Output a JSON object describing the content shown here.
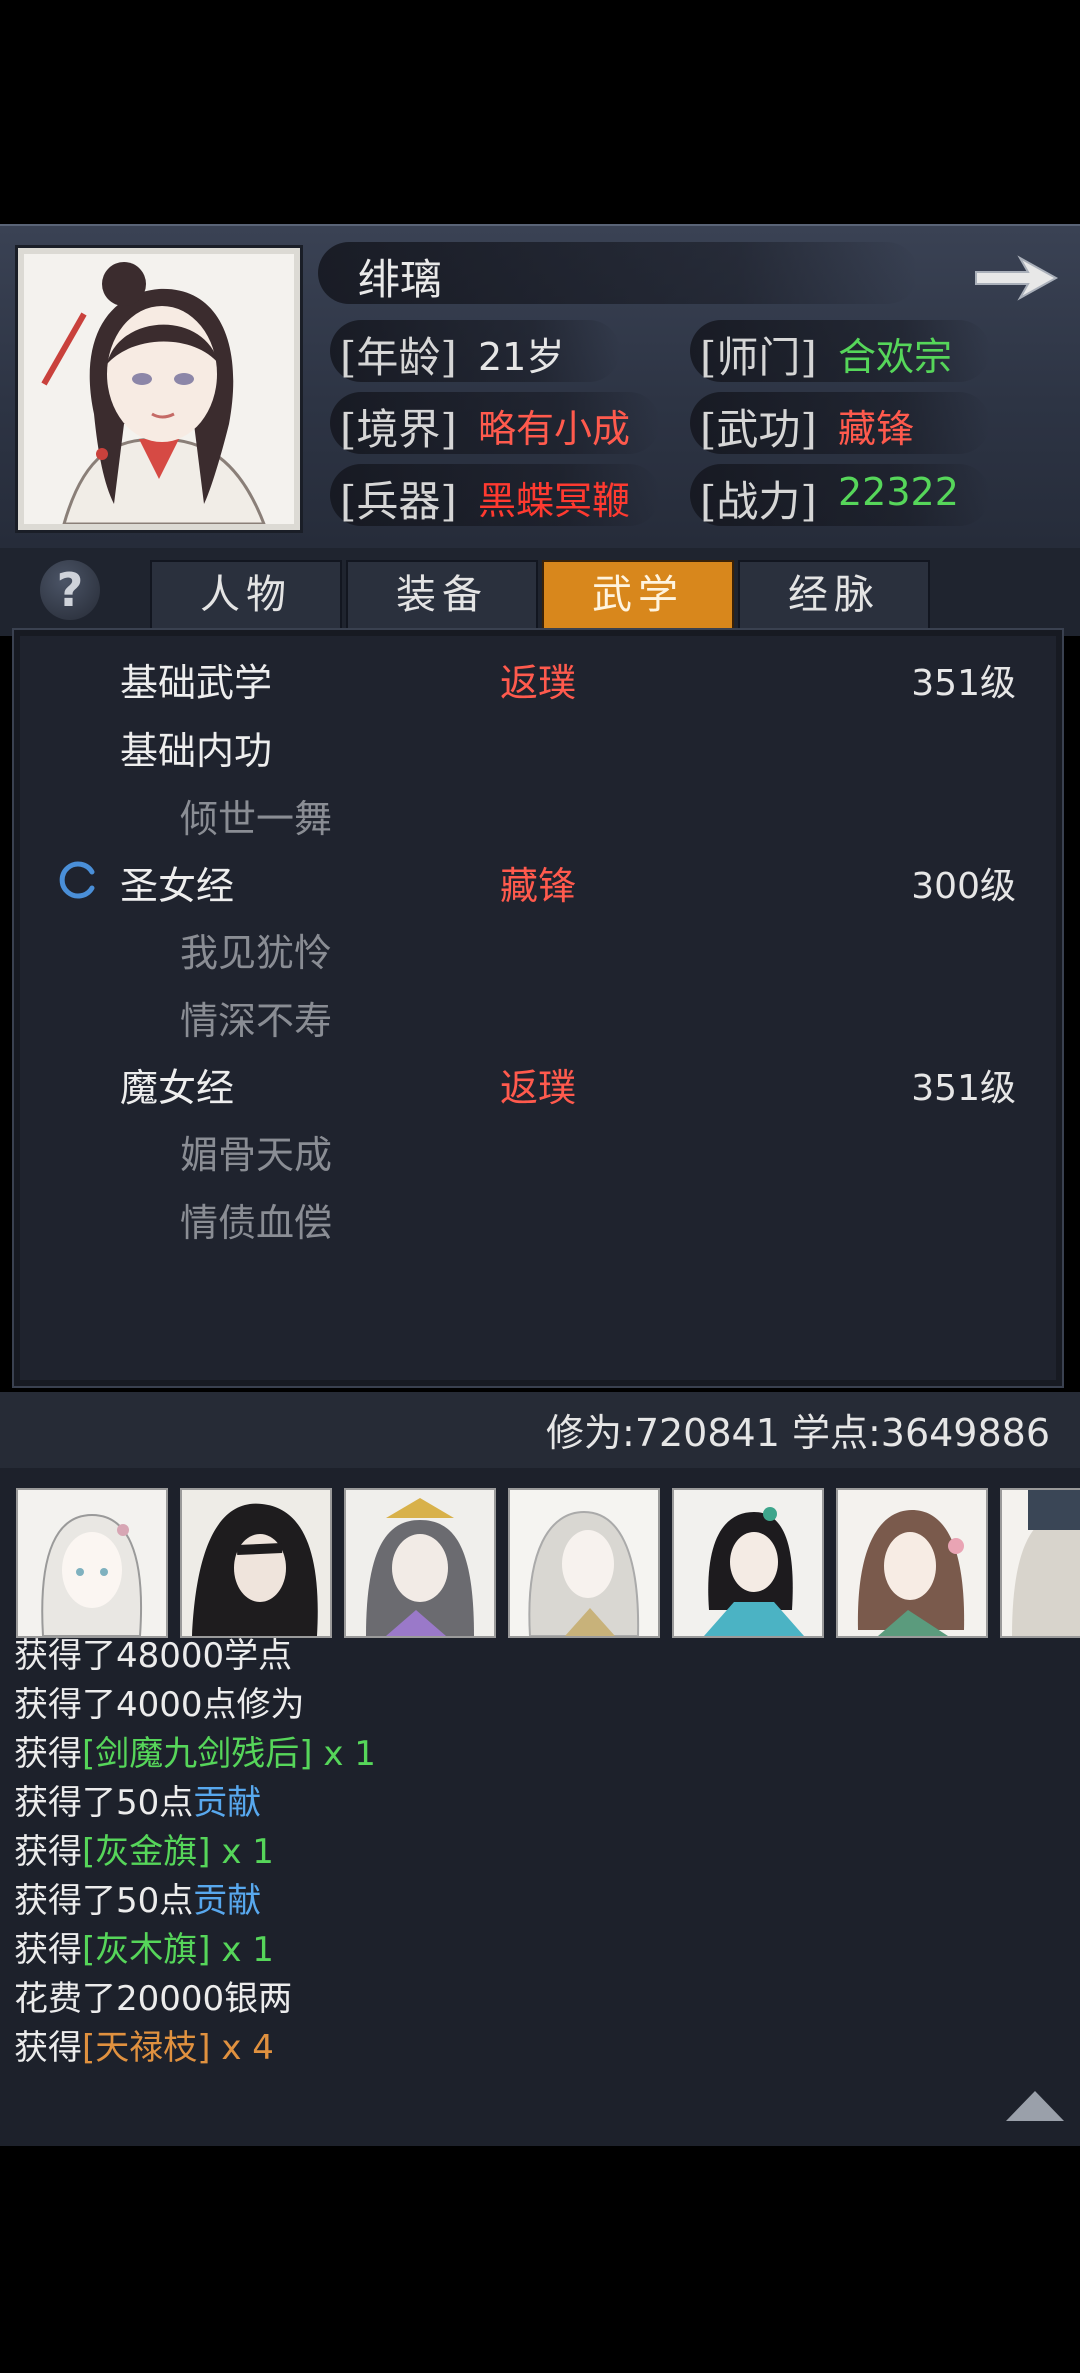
{
  "character": {
    "name": "绯璃",
    "fields": {
      "age_label": "[年龄]",
      "age_value": "21岁",
      "sect_label": "[师门]",
      "sect_value": "合欢宗",
      "realm_label": "[境界]",
      "realm_value": "略有小成",
      "martial_label": "[武功]",
      "martial_value": "藏锋",
      "weapon_label": "[兵器]",
      "weapon_value": "黑蝶冥鞭",
      "power_label": "[战力]",
      "power_value": "22322"
    }
  },
  "tabs": [
    {
      "label": "人物",
      "active": false
    },
    {
      "label": "装备",
      "active": false
    },
    {
      "label": "武学",
      "active": true
    },
    {
      "label": "经脉",
      "active": false
    }
  ],
  "help_icon": "?",
  "skills": [
    {
      "name": "基础武学",
      "tier": "返璞",
      "level": "351级"
    },
    {
      "name": "基础内功"
    },
    {
      "sub": "倾世一舞"
    },
    {
      "name": "圣女经",
      "tier": "藏锋",
      "level": "300级"
    },
    {
      "sub": "我见犹怜"
    },
    {
      "sub": "情深不寿"
    },
    {
      "name": "魔女经",
      "tier": "返璞",
      "level": "351级"
    },
    {
      "sub": "媚骨天成"
    },
    {
      "sub": "情债血偿"
    }
  ],
  "stats": "修为:720841 学点:3649886",
  "log": [
    {
      "parts": [
        {
          "t": "获得了48000学点"
        }
      ]
    },
    {
      "parts": [
        {
          "t": "获得了4000点修为"
        }
      ]
    },
    {
      "parts": [
        {
          "t": "获得"
        },
        {
          "t": "[剑魔九剑残后]",
          "c": "green"
        },
        {
          "t": " x 1",
          "c": "green"
        }
      ]
    },
    {
      "parts": [
        {
          "t": "获得了50点"
        },
        {
          "t": "贡献",
          "c": "blue"
        }
      ]
    },
    {
      "parts": [
        {
          "t": "获得"
        },
        {
          "t": "[灰金旗]",
          "c": "green"
        },
        {
          "t": " x 1",
          "c": "green"
        }
      ]
    },
    {
      "parts": [
        {
          "t": "获得了50点"
        },
        {
          "t": "贡献",
          "c": "blue"
        }
      ]
    },
    {
      "parts": [
        {
          "t": "获得"
        },
        {
          "t": "[灰木旗]",
          "c": "green"
        },
        {
          "t": " x 1",
          "c": "green"
        }
      ]
    },
    {
      "parts": [
        {
          "t": "花费了20000银两"
        }
      ]
    },
    {
      "parts": [
        {
          "t": "获得"
        },
        {
          "t": "[天禄枝]",
          "c": "orange"
        },
        {
          "t": " x 4",
          "c": "orange"
        }
      ]
    }
  ],
  "colors": {
    "tab_active": "#d8871c",
    "value_red": "#ff5a4d",
    "value_green": "#56d65a",
    "log_blue": "#58a8ee",
    "log_orange": "#e0913f"
  },
  "icons": {
    "next": "arrow-right-icon",
    "help": "question-icon",
    "loading": "spinner-icon",
    "scroll": "triangle-up-icon"
  }
}
